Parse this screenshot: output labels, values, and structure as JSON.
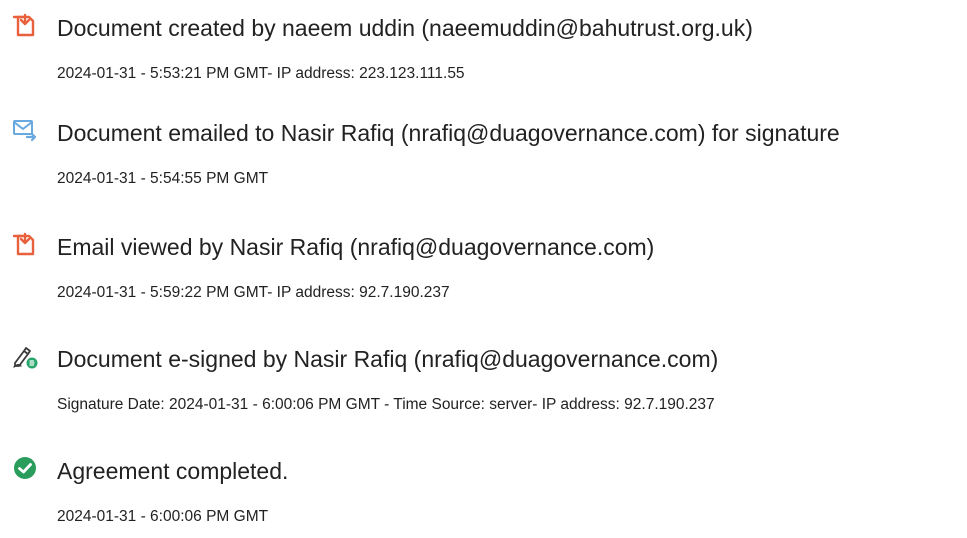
{
  "events": [
    {
      "icon": "document-created-icon",
      "title": "Document created by naeem uddin (naeemuddin@bahutrust.org.uk)",
      "meta": "2024-01-31 - 5:53:21 PM GMT- IP address: 223.123.111.55"
    },
    {
      "icon": "email-sent-icon",
      "title": "Document emailed to Nasir Rafiq (nrafiq@duagovernance.com) for signature",
      "meta": "2024-01-31 - 5:54:55 PM GMT"
    },
    {
      "icon": "document-viewed-icon",
      "title": "Email viewed by Nasir Rafiq (nrafiq@duagovernance.com)",
      "meta": "2024-01-31 - 5:59:22 PM GMT- IP address: 92.7.190.237"
    },
    {
      "icon": "e-sign-pen-icon",
      "title": "Document e-signed by Nasir Rafiq (nrafiq@duagovernance.com)",
      "meta": "Signature Date: 2024-01-31 - 6:00:06 PM GMT - Time Source: server- IP address: 92.7.190.237"
    },
    {
      "icon": "check-circle-icon",
      "title": "Agreement completed.",
      "meta": "2024-01-31 - 6:00:06 PM GMT"
    }
  ],
  "colors": {
    "document_icon": "#e8603c",
    "email_icon": "#6aa8e0",
    "pen_icon": "#3a3a3a",
    "pen_badge": "#27a56a",
    "check_icon": "#2a9d5c"
  }
}
